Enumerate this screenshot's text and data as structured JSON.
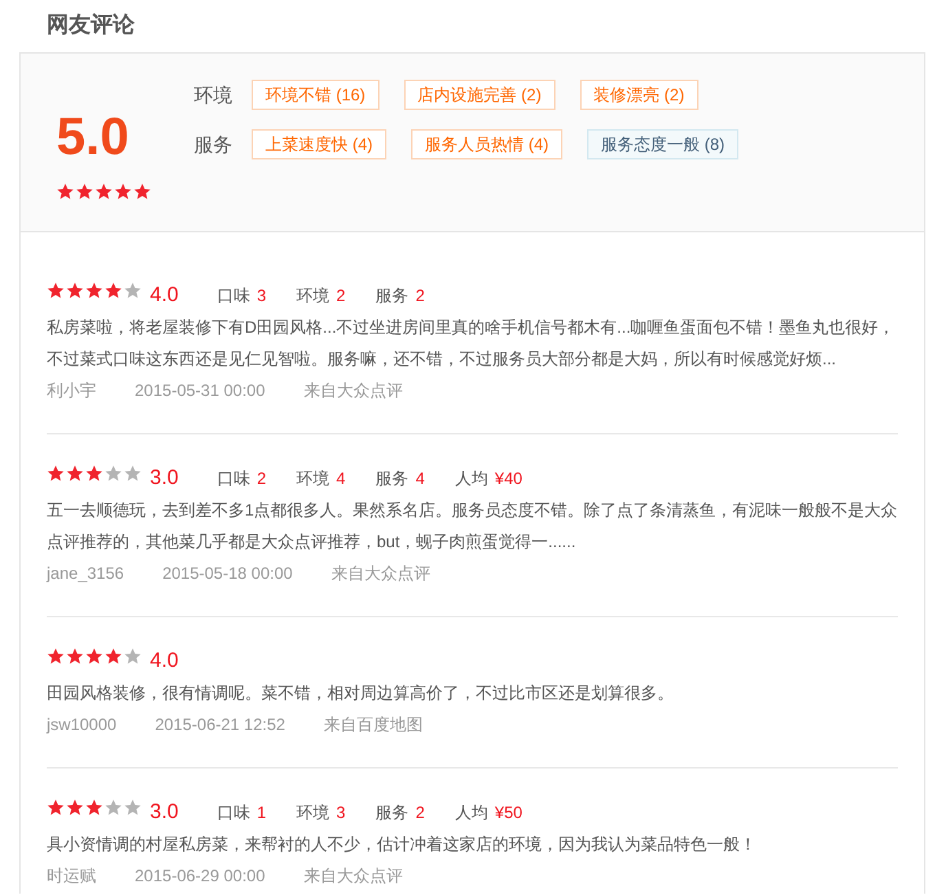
{
  "title": "网友评论",
  "summary": {
    "score": "5.0",
    "stars": 5,
    "tag_groups": [
      {
        "label": "环境",
        "tags": [
          {
            "text": "环境不错 (16)",
            "kind": "positive"
          },
          {
            "text": "店内设施完善 (2)",
            "kind": "positive"
          },
          {
            "text": "装修漂亮 (2)",
            "kind": "positive"
          }
        ]
      },
      {
        "label": "服务",
        "tags": [
          {
            "text": "上菜速度快 (4)",
            "kind": "positive"
          },
          {
            "text": "服务人员热情 (4)",
            "kind": "positive"
          },
          {
            "text": "服务态度一般 (8)",
            "kind": "neutral"
          }
        ]
      }
    ]
  },
  "reviews": [
    {
      "stars": 4,
      "score": "4.0",
      "metrics": [
        {
          "label": "口味",
          "value": "3"
        },
        {
          "label": "环境",
          "value": "2"
        },
        {
          "label": "服务",
          "value": "2"
        }
      ],
      "text": "私房菜啦，将老屋装修下有D田园风格...不过坐进房间里真的啥手机信号都木有...咖喱鱼蛋面包不错！墨鱼丸也很好，不过菜式口味这东西还是见仁见智啦。服务嘛，还不错，不过服务员大部分都是大妈，所以有时候感觉好烦...",
      "user": "利小宇",
      "time": "2015-05-31 00:00",
      "source": "来自大众点评"
    },
    {
      "stars": 3,
      "score": "3.0",
      "metrics": [
        {
          "label": "口味",
          "value": "2"
        },
        {
          "label": "环境",
          "value": "4"
        },
        {
          "label": "服务",
          "value": "4"
        },
        {
          "label": "人均",
          "value": "¥40"
        }
      ],
      "text": "五一去顺德玩，去到差不多1点都很多人。果然系名店。服务员态度不错。除了点了条清蒸鱼，有泥味一般般不是大众点评推荐的，其他菜几乎都是大众点评推荐，but，蚬子肉煎蛋觉得一......",
      "user": "jane_3156",
      "time": "2015-05-18 00:00",
      "source": "来自大众点评"
    },
    {
      "stars": 4,
      "score": "4.0",
      "text": "田园风格装修，很有情调呢。菜不错，相对周边算高价了，不过比市区还是划算很多。",
      "user": "jsw10000",
      "time": "2015-06-21 12:52",
      "source": "来自百度地图"
    },
    {
      "stars": 3,
      "score": "3.0",
      "metrics": [
        {
          "label": "口味",
          "value": "1"
        },
        {
          "label": "环境",
          "value": "3"
        },
        {
          "label": "服务",
          "value": "2"
        },
        {
          "label": "人均",
          "value": "¥50"
        }
      ],
      "text": "具小资情调的村屋私房菜，来帮衬的人不少，估计冲着这家店的环境，因为我认为菜品特色一般！",
      "user": "时运赋",
      "time": "2015-06-29 00:00",
      "source": "来自大众点评"
    }
  ]
}
